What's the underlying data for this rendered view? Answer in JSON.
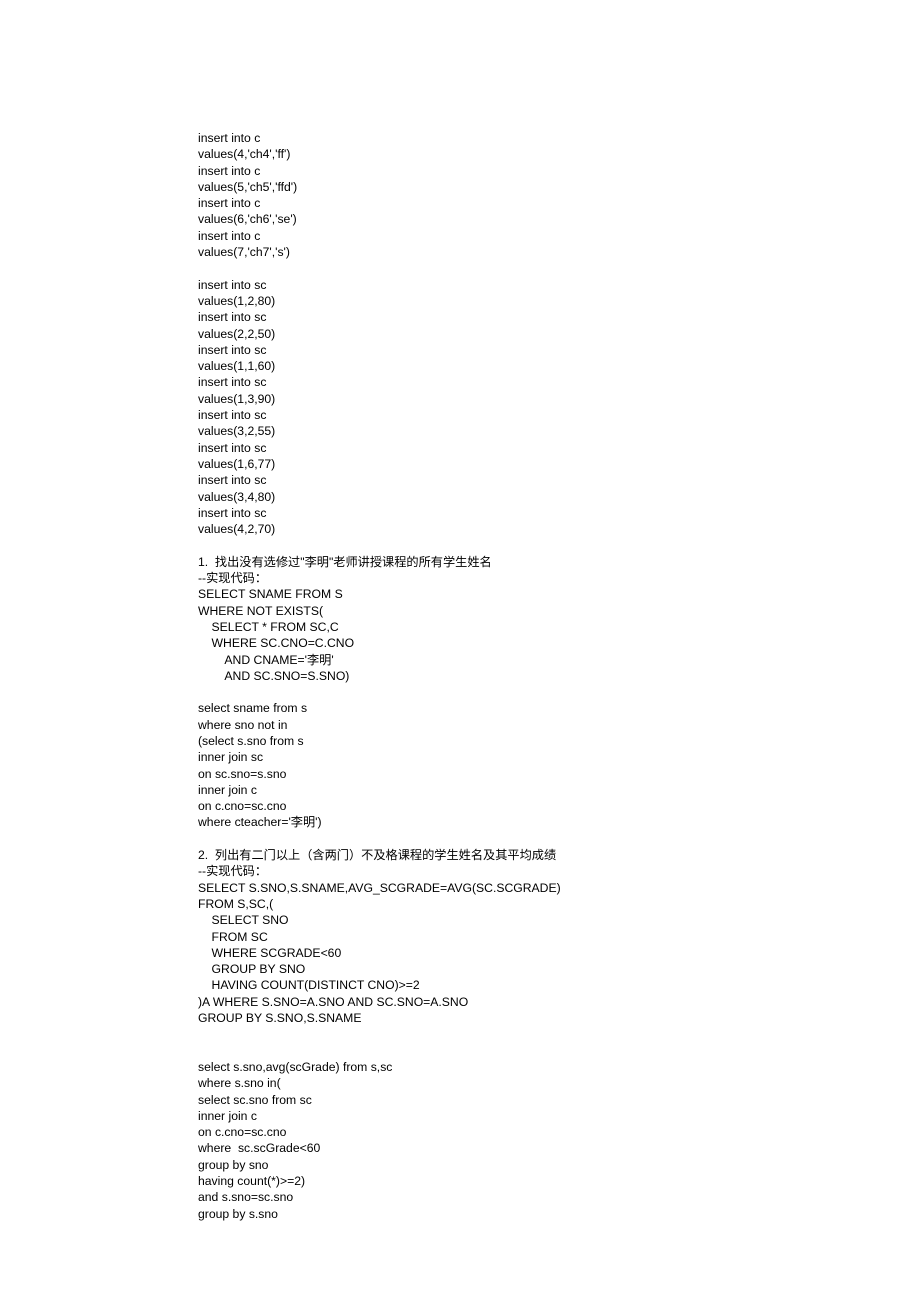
{
  "blocks": [
    {
      "type": "line",
      "text": "insert into c"
    },
    {
      "type": "line",
      "text": "values(4,'ch4','ff')"
    },
    {
      "type": "line",
      "text": "insert into c"
    },
    {
      "type": "line",
      "text": "values(5,'ch5','ffd')"
    },
    {
      "type": "line",
      "text": "insert into c"
    },
    {
      "type": "line",
      "text": "values(6,'ch6','se')"
    },
    {
      "type": "line",
      "text": "insert into c"
    },
    {
      "type": "line",
      "text": "values(7,'ch7','s')"
    },
    {
      "type": "gap"
    },
    {
      "type": "line",
      "text": "insert into sc"
    },
    {
      "type": "line",
      "text": "values(1,2,80)"
    },
    {
      "type": "line",
      "text": "insert into sc"
    },
    {
      "type": "line",
      "text": "values(2,2,50)"
    },
    {
      "type": "line",
      "text": "insert into sc"
    },
    {
      "type": "line",
      "text": "values(1,1,60)"
    },
    {
      "type": "line",
      "text": "insert into sc"
    },
    {
      "type": "line",
      "text": "values(1,3,90)"
    },
    {
      "type": "line",
      "text": "insert into sc"
    },
    {
      "type": "line",
      "text": "values(3,2,55)"
    },
    {
      "type": "line",
      "text": "insert into sc"
    },
    {
      "type": "line",
      "text": "values(1,6,77)"
    },
    {
      "type": "line",
      "text": "insert into sc"
    },
    {
      "type": "line",
      "text": "values(3,4,80)"
    },
    {
      "type": "line",
      "text": "insert into sc"
    },
    {
      "type": "line",
      "text": "values(4,2,70)"
    },
    {
      "type": "gap"
    },
    {
      "type": "line",
      "text": "1.  找出没有选修过\"李明\"老师讲授课程的所有学生姓名"
    },
    {
      "type": "line",
      "text": "--实现代码："
    },
    {
      "type": "line",
      "text": "SELECT SNAME FROM S"
    },
    {
      "type": "line",
      "text": "WHERE NOT EXISTS("
    },
    {
      "type": "line",
      "text": "    SELECT * FROM SC,C"
    },
    {
      "type": "line",
      "text": "    WHERE SC.CNO=C.CNO"
    },
    {
      "type": "line",
      "text": "        AND CNAME='李明'"
    },
    {
      "type": "line",
      "text": "        AND SC.SNO=S.SNO)"
    },
    {
      "type": "gap"
    },
    {
      "type": "line",
      "text": "select sname from s"
    },
    {
      "type": "line",
      "text": "where sno not in"
    },
    {
      "type": "line",
      "text": "(select s.sno from s"
    },
    {
      "type": "line",
      "text": "inner join sc"
    },
    {
      "type": "line",
      "text": "on sc.sno=s.sno"
    },
    {
      "type": "line",
      "text": "inner join c"
    },
    {
      "type": "line",
      "text": "on c.cno=sc.cno"
    },
    {
      "type": "line",
      "text": "where cteacher='李明')"
    },
    {
      "type": "gap"
    },
    {
      "type": "line",
      "text": "2.  列出有二门以上（含两门）不及格课程的学生姓名及其平均成绩"
    },
    {
      "type": "line",
      "text": "--实现代码："
    },
    {
      "type": "line",
      "text": "SELECT S.SNO,S.SNAME,AVG_SCGRADE=AVG(SC.SCGRADE)"
    },
    {
      "type": "line",
      "text": "FROM S,SC,("
    },
    {
      "type": "line",
      "text": "    SELECT SNO"
    },
    {
      "type": "line",
      "text": "    FROM SC"
    },
    {
      "type": "line",
      "text": "    WHERE SCGRADE<60"
    },
    {
      "type": "line",
      "text": "    GROUP BY SNO"
    },
    {
      "type": "line",
      "text": "    HAVING COUNT(DISTINCT CNO)>=2"
    },
    {
      "type": "line",
      "text": ")A WHERE S.SNO=A.SNO AND SC.SNO=A.SNO"
    },
    {
      "type": "line",
      "text": "GROUP BY S.SNO,S.SNAME"
    },
    {
      "type": "gap2"
    },
    {
      "type": "line",
      "text": "select s.sno,avg(scGrade) from s,sc"
    },
    {
      "type": "line",
      "text": "where s.sno in("
    },
    {
      "type": "line",
      "text": "select sc.sno from sc"
    },
    {
      "type": "line",
      "text": "inner join c"
    },
    {
      "type": "line",
      "text": "on c.cno=sc.cno"
    },
    {
      "type": "line",
      "text": "where  sc.scGrade<60"
    },
    {
      "type": "line",
      "text": "group by sno"
    },
    {
      "type": "line",
      "text": "having count(*)>=2)"
    },
    {
      "type": "line",
      "text": "and s.sno=sc.sno"
    },
    {
      "type": "line",
      "text": "group by s.sno"
    }
  ]
}
